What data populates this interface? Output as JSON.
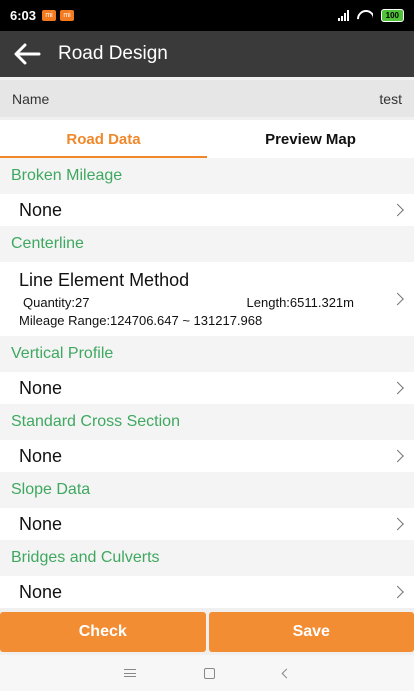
{
  "status_bar": {
    "time": "6:03",
    "notifications": [
      "mi",
      "mi"
    ],
    "battery": "100"
  },
  "toolbar": {
    "back_icon": "arrow-left-icon",
    "title": "Road Design"
  },
  "name_row": {
    "label": "Name",
    "value": "test"
  },
  "tabs": [
    {
      "label": "Road Data",
      "active": true
    },
    {
      "label": "Preview Map",
      "active": false
    }
  ],
  "sections": {
    "broken_mileage": {
      "title": "Broken Mileage",
      "value": "None"
    },
    "centerline": {
      "title": "Centerline",
      "method": "Line Element Method",
      "quantity": "Quantity:27",
      "length": "Length:6511.321m",
      "range": "Mileage Range:124706.647 ~ 131217.968"
    },
    "vertical_profile": {
      "title": "Vertical Profile",
      "value": "None"
    },
    "standard_cross_section": {
      "title": "Standard Cross Section",
      "value": "None"
    },
    "slope_data": {
      "title": "Slope Data",
      "value": "None"
    },
    "bridges_and_culverts": {
      "title": "Bridges and Culverts",
      "value": "None"
    }
  },
  "buttons": {
    "check": "Check",
    "save": "Save"
  },
  "colors": {
    "accent": "#f38d34",
    "section_title": "#3fa860",
    "toolbar": "#3a3a3a"
  }
}
